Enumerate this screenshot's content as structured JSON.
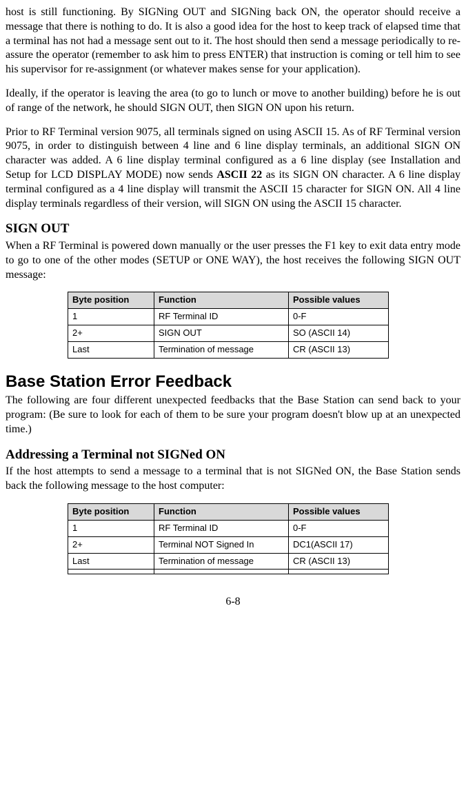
{
  "p1": "host is still functioning. By SIGNing OUT and SIGNing back ON, the operator should receive a message that there is nothing to do. It is also a good idea for the host to keep track of elapsed time that a terminal has not had a message sent out to it. The host should then send a message periodically to re-assure the operator (remember to ask him to press ENTER) that instruction is coming or tell him to see his supervisor for re-assignment (or whatever makes sense for your application).",
  "p2": "Ideally, if the operator is leaving the area (to go to lunch or move to another building) before he is out of range of the network, he should SIGN OUT, then SIGN ON upon his return.",
  "p3a": "Prior to RF Terminal version 9075, all terminals signed on using ASCII 15.  As of RF Terminal version 9075, in order to distinguish between 4 line and 6 line display terminals, an additional SIGN ON character was added.  A 6 line display terminal configured as a 6 line display (see Installation and Setup for LCD DISPLAY MODE) now sends ",
  "p3bold": "ASCII 22",
  "p3b": " as its SIGN ON character. A 6 line display terminal configured as a 4 line display will transmit the ASCII 15 character for SIGN ON. All 4 line display terminals regardless of their version, will SIGN ON using the ASCII 15 character.",
  "h_signout": "SIGN OUT",
  "p4": "When a RF Terminal is powered down manually or the user presses the F1 key to exit data entry mode to go to one of the other modes (SETUP or ONE WAY), the host receives the following SIGN OUT message:",
  "th1": "Byte position",
  "th2": "Function",
  "th3": "Possible values",
  "t1": {
    "r1": {
      "c1": "1",
      "c2": "RF Terminal ID",
      "c3": "0-F"
    },
    "r2": {
      "c1": "2+",
      "c2": "SIGN OUT",
      "c3": "SO (ASCII 14)"
    },
    "r3": {
      "c1": "Last",
      "c2": "Termination of message",
      "c3": "CR (ASCII 13)"
    }
  },
  "h_base": "Base Station Error Feedback",
  "p5": "The following are four different unexpected feedbacks that the Base Station can send back to your program: (Be sure to look for each of them to be sure your program doesn't blow up at an unexpected time.)",
  "h_addr": "Addressing a Terminal not SIGNed ON",
  "p6": "If the host attempts to send a message to a terminal that is not SIGNed ON, the Base Station sends back the following message to the host computer:",
  "t2": {
    "r1": {
      "c1": "1",
      "c2": "RF Terminal ID",
      "c3": "0-F"
    },
    "r2": {
      "c1": "2+",
      "c2": "Terminal NOT Signed In",
      "c3": "DC1(ASCII 17)"
    },
    "r3": {
      "c1": "Last",
      "c2": "Termination of message",
      "c3": "CR (ASCII 13)"
    },
    "r4": {
      "c1": "",
      "c2": "",
      "c3": ""
    }
  },
  "pagenum": "6-8"
}
